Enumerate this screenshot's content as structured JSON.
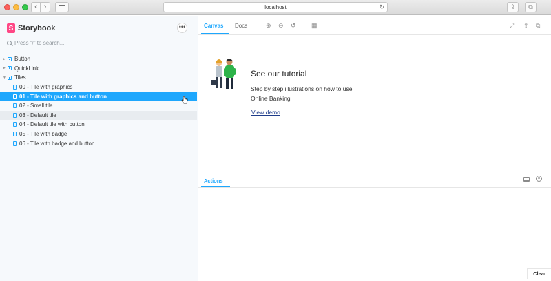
{
  "browser": {
    "url": "localhost"
  },
  "sidebar": {
    "brand": "Storybook",
    "more_label": "•••",
    "search_placeholder": "Press \"/\" to search...",
    "groups": [
      {
        "label": "Button"
      },
      {
        "label": "QuickLink"
      },
      {
        "label": "Tiles"
      }
    ],
    "stories": [
      {
        "label": "00 - Tile with graphics"
      },
      {
        "label": "01 - Tile with graphics and button"
      },
      {
        "label": "02 - Small tile"
      },
      {
        "label": "03 - Default tile"
      },
      {
        "label": "04 - Default tile with button"
      },
      {
        "label": "05 - Tile with badge"
      },
      {
        "label": "06 - Tile with badge and button"
      }
    ]
  },
  "toolbar": {
    "tab_canvas": "Canvas",
    "tab_docs": "Docs"
  },
  "canvas": {
    "title": "See our tutorial",
    "text": "Step by step illustrations on how to use Online Banking",
    "link": "View demo"
  },
  "addons": {
    "tab_actions": "Actions",
    "clear_label": "Clear"
  },
  "colors": {
    "accent": "#1ea7fd",
    "brand": "#ff4785",
    "link": "#1e3c8a"
  }
}
